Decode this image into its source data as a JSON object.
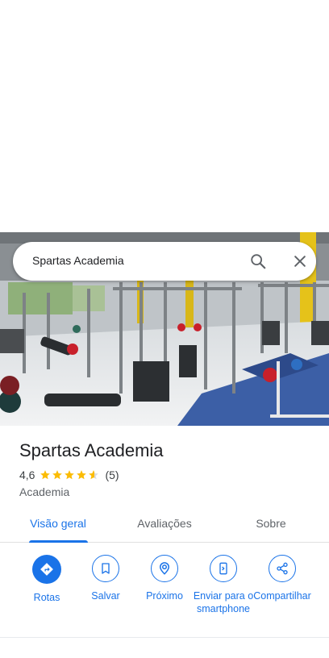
{
  "search": {
    "query": "Spartas Academia"
  },
  "place": {
    "name": "Spartas Academia",
    "rating": "4,6",
    "stars": 4.6,
    "reviews": "(5)",
    "category": "Academia"
  },
  "tabs": [
    {
      "label": "Visão geral"
    },
    {
      "label": "Avaliações"
    },
    {
      "label": "Sobre"
    }
  ],
  "actions": [
    {
      "label": "Rotas",
      "icon": "directions-icon"
    },
    {
      "label": "Salvar",
      "icon": "bookmark-icon"
    },
    {
      "label": "Próximo",
      "icon": "nearby-icon"
    },
    {
      "label": "Enviar para o smartphone",
      "icon": "send-to-phone-icon"
    },
    {
      "label": "Compartilhar",
      "icon": "share-icon"
    }
  ],
  "colors": {
    "accent": "#1a73e8",
    "star": "#fbbc04"
  }
}
